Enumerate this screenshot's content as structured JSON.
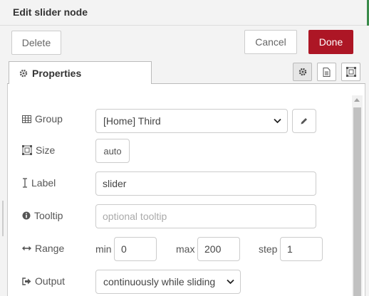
{
  "header": {
    "title": "Edit slider node"
  },
  "toolbar": {
    "delete_label": "Delete",
    "cancel_label": "Cancel",
    "done_label": "Done"
  },
  "tabs": {
    "properties_label": "Properties"
  },
  "form": {
    "group": {
      "label": "Group",
      "value": "[Home] Third"
    },
    "size": {
      "label": "Size",
      "value": "auto"
    },
    "label_field": {
      "label": "Label",
      "value": "slider"
    },
    "tooltip": {
      "label": "Tooltip",
      "placeholder": "optional tooltip"
    },
    "range": {
      "label": "Range",
      "min_label": "min",
      "min_value": "0",
      "max_label": "max",
      "max_value": "200",
      "step_label": "step",
      "step_value": "1"
    },
    "output": {
      "label": "Output",
      "value": "continuously while sliding"
    }
  },
  "colors": {
    "done_button": "#ad1625",
    "tray_edge": "#3b8b4a"
  }
}
